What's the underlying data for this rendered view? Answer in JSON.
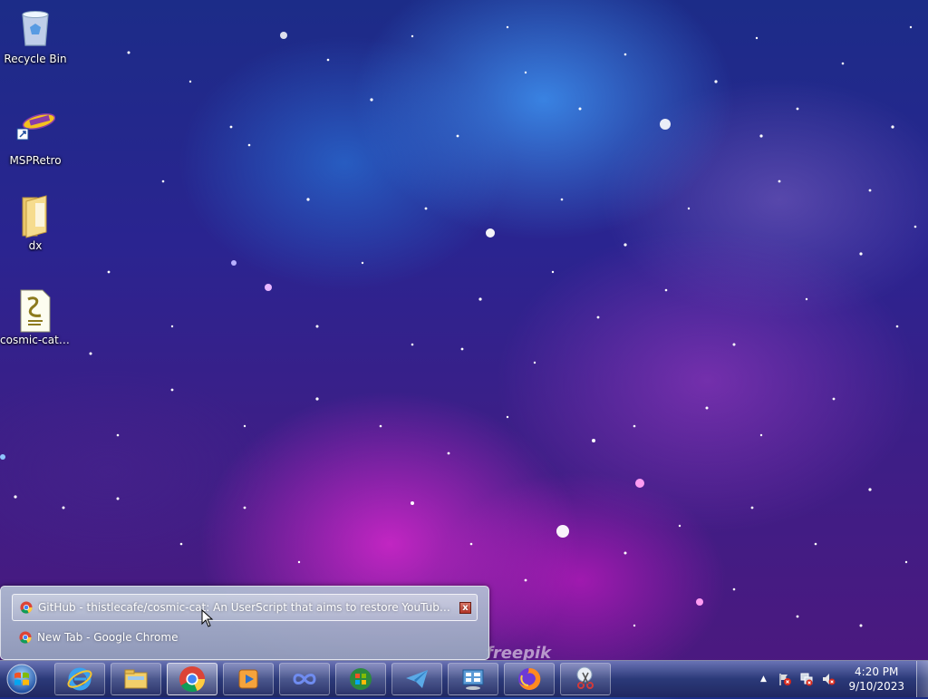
{
  "desktop": {
    "icons": [
      {
        "label": "Recycle Bin",
        "icon": "recycle-bin-icon"
      },
      {
        "label": "MSPRetro",
        "icon": "msp-retro-icon"
      },
      {
        "label": "dx",
        "icon": "folder-icon"
      },
      {
        "label": "cosmic-cat....",
        "icon": "script-file-icon"
      }
    ],
    "watermark": "freepik"
  },
  "thumbnail_popup": {
    "items": [
      {
        "label": "GitHub - thistlecafe/cosmic-cat: An UserScript that aims to restore YouTube's 2012 layo...",
        "selected": true
      },
      {
        "label": "New Tab - Google Chrome",
        "selected": false
      }
    ],
    "close_glyph": "x"
  },
  "taskbar": {
    "start_icon": "windows-orb-icon",
    "buttons": [
      {
        "name": "internet-explorer",
        "icon": "internet-explorer-icon"
      },
      {
        "name": "file-explorer",
        "icon": "file-explorer-icon"
      },
      {
        "name": "google-chrome",
        "icon": "chrome-icon",
        "active": true
      },
      {
        "name": "media-player",
        "icon": "media-player-icon"
      },
      {
        "name": "infinity-app",
        "icon": "infinity-icon"
      },
      {
        "name": "windows-app",
        "icon": "windows-logo-icon"
      },
      {
        "name": "telegram",
        "icon": "paper-plane-icon"
      },
      {
        "name": "control-panel",
        "icon": "control-panel-icon"
      },
      {
        "name": "firefox",
        "icon": "firefox-icon"
      },
      {
        "name": "snipping-tool",
        "icon": "scissors-icon"
      }
    ],
    "tray": {
      "show_hidden": "▲",
      "clock_time": "4:20 PM",
      "clock_date": "9/10/2023"
    }
  }
}
